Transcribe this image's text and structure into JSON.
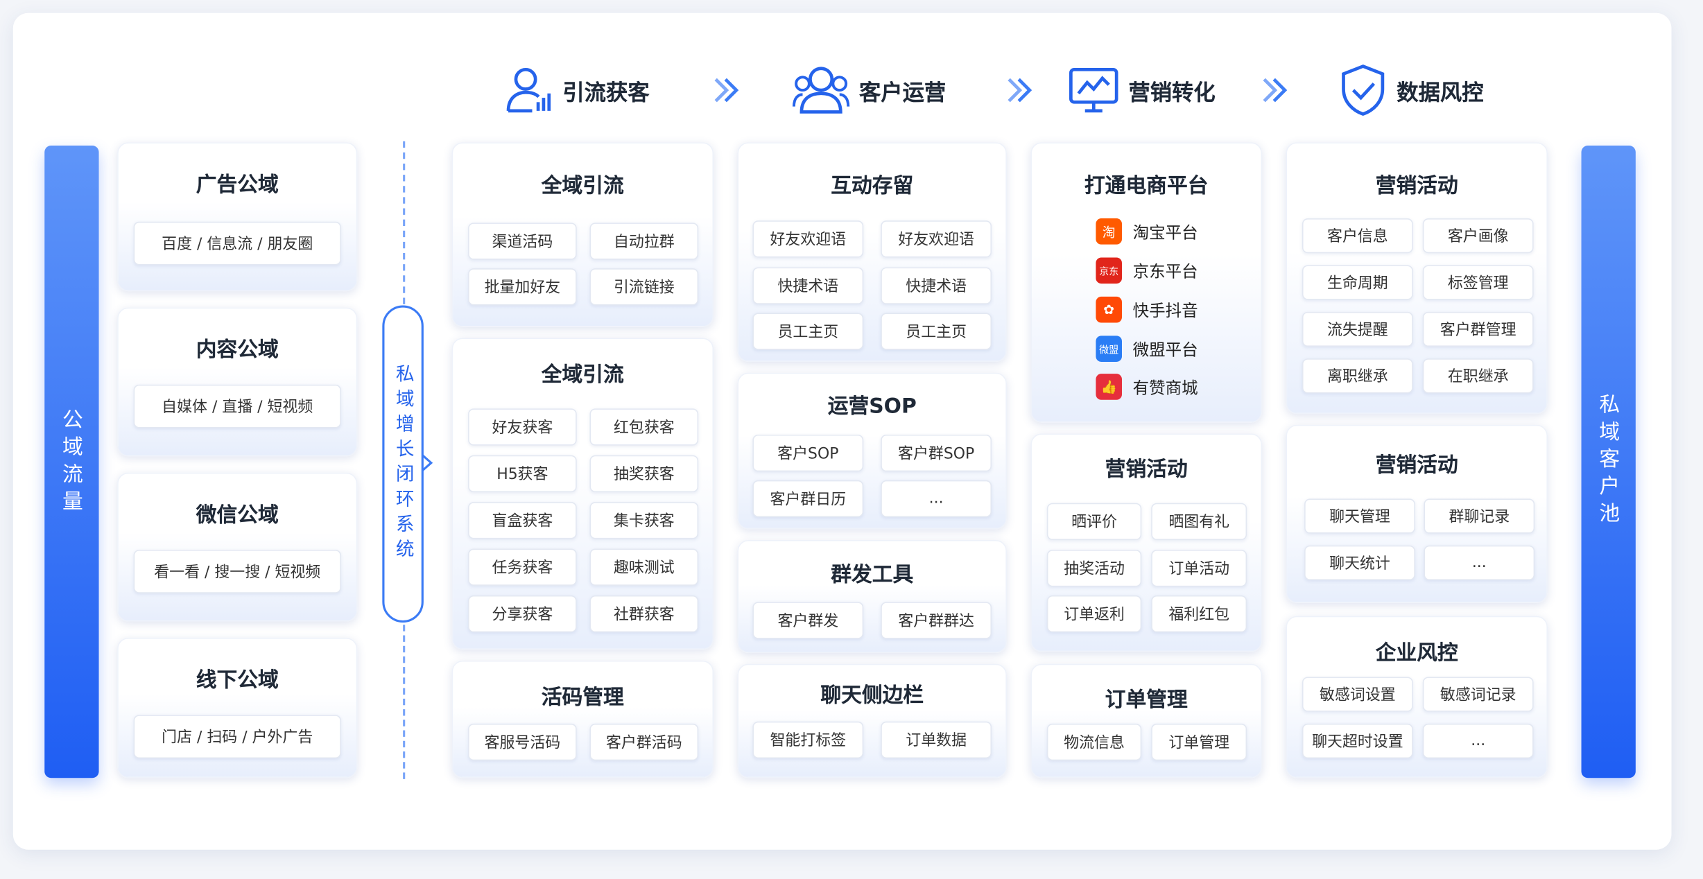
{
  "header": {
    "steps": [
      {
        "label": "引流获客"
      },
      {
        "label": "客户运营"
      },
      {
        "label": "营销转化"
      },
      {
        "label": "数据风控"
      }
    ]
  },
  "left_bar": "公域流量",
  "right_bar": "私域客户池",
  "loop_label": "私域增长闭环系统",
  "public_domains": [
    {
      "title": "广告公域",
      "sub": "百度 / 信息流 / 朋友圈"
    },
    {
      "title": "内容公域",
      "sub": "自媒体 / 直播 / 短视频"
    },
    {
      "title": "微信公域",
      "sub": "看一看 / 搜一搜 / 短视频"
    },
    {
      "title": "线下公域",
      "sub": "门店 / 扫码 / 户外广告"
    }
  ],
  "col1": [
    {
      "title": "全域引流",
      "items": [
        "渠道活码",
        "自动拉群",
        "批量加好友",
        "引流链接"
      ]
    },
    {
      "title": "全域引流",
      "items": [
        "好友获客",
        "红包获客",
        "H5获客",
        "抽奖获客",
        "盲盒获客",
        "集卡获客",
        "任务获客",
        "趣味测试",
        "分享获客",
        "社群获客"
      ]
    },
    {
      "title": "活码管理",
      "items": [
        "客服号活码",
        "客户群活码"
      ]
    }
  ],
  "col2": [
    {
      "title": "互动存留",
      "items": [
        "好友欢迎语",
        "好友欢迎语",
        "快捷术语",
        "快捷术语",
        "员工主页",
        "员工主页"
      ]
    },
    {
      "title": "运营SOP",
      "items": [
        "客户SOP",
        "客户群SOP",
        "客户群日历",
        "..."
      ]
    },
    {
      "title": "群发工具",
      "items": [
        "客户群发",
        "客户群群达"
      ]
    },
    {
      "title": "聊天侧边栏",
      "items": [
        "智能打标签",
        "订单数据"
      ]
    }
  ],
  "col3": [
    {
      "title": "打通电商平台",
      "platforms": [
        {
          "icon": "淘",
          "name": "淘宝平台",
          "color": "#ff5a00"
        },
        {
          "icon": "京东",
          "name": "京东平台",
          "color": "#e1251b"
        },
        {
          "icon": "✿",
          "name": "快手抖音",
          "color": "#ff4906"
        },
        {
          "icon": "微盟",
          "name": "微盟平台",
          "color": "#2a7df5"
        },
        {
          "icon": "👍",
          "name": "有赞商城",
          "color": "#e62e3c"
        }
      ]
    },
    {
      "title": "营销活动",
      "items": [
        "晒评价",
        "晒图有礼",
        "抽奖活动",
        "订单活动",
        "订单返利",
        "福利红包"
      ]
    },
    {
      "title": "订单管理",
      "items": [
        "物流信息",
        "订单管理"
      ]
    }
  ],
  "col4": [
    {
      "title": "营销活动",
      "items": [
        "客户信息",
        "客户画像",
        "生命周期",
        "标签管理",
        "流失提醒",
        "客户群管理",
        "离职继承",
        "在职继承"
      ]
    },
    {
      "title": "营销活动",
      "items": [
        "聊天管理",
        "群聊记录",
        "聊天统计",
        "..."
      ]
    },
    {
      "title": "企业风控",
      "items": [
        "敏感词设置",
        "敏感词记录",
        "聊天超时设置",
        "..."
      ]
    }
  ]
}
